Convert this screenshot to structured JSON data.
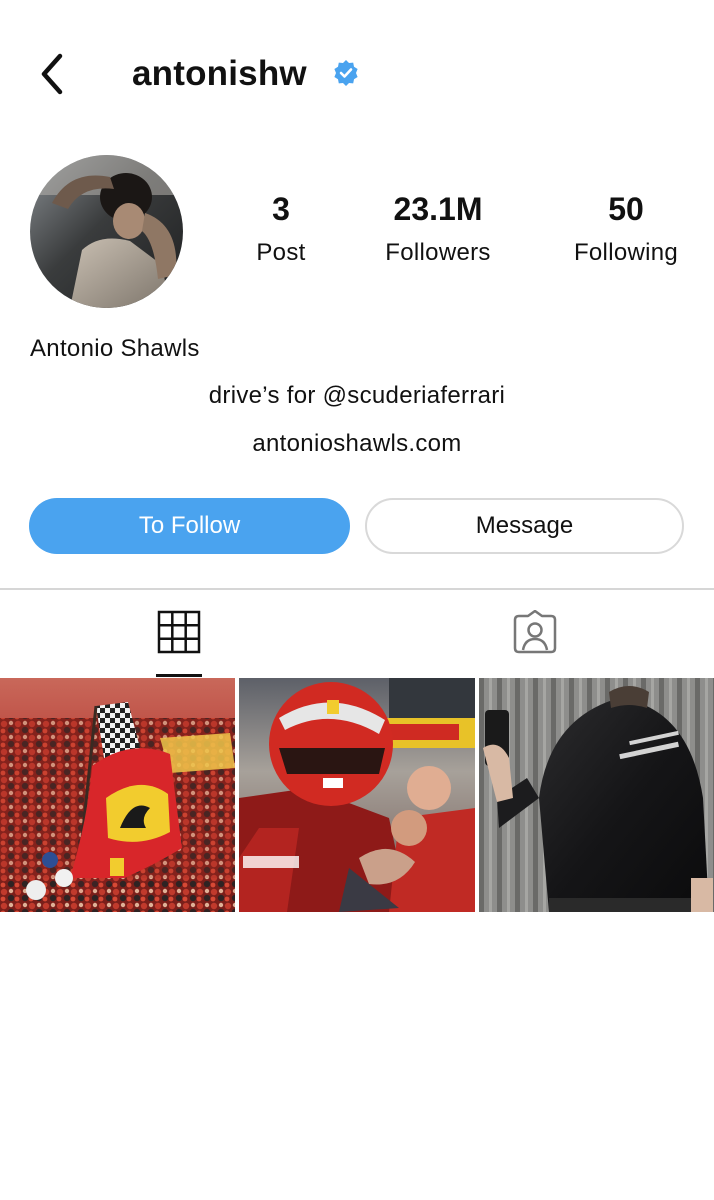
{
  "header": {
    "username": "antonishw",
    "back_icon": "chevron-left-icon",
    "verified_icon": "verified-badge-icon",
    "verified_color": "#4aa3ef"
  },
  "profile": {
    "full_name": "Antonio Shawls",
    "bio_lines": [
      "drive’s for @scuderiaferrari",
      "antonioshawls.com"
    ]
  },
  "stats": [
    {
      "value": "3",
      "label": "Post"
    },
    {
      "value": "23.1M",
      "label": "Followers"
    },
    {
      "value": "50",
      "label": "Following"
    }
  ],
  "actions": {
    "follow_label": "To Follow",
    "message_label": "Message",
    "follow_color": "#4aa3ef"
  },
  "tabs": [
    {
      "icon": "grid-icon",
      "active": true
    },
    {
      "icon": "tagged-person-icon",
      "active": false
    }
  ],
  "posts": [
    {
      "subject": "ferrari-fans-flag-photo"
    },
    {
      "subject": "driver-helmet-celebration-photo"
    },
    {
      "subject": "mirror-selfie-jacket-photo"
    }
  ]
}
